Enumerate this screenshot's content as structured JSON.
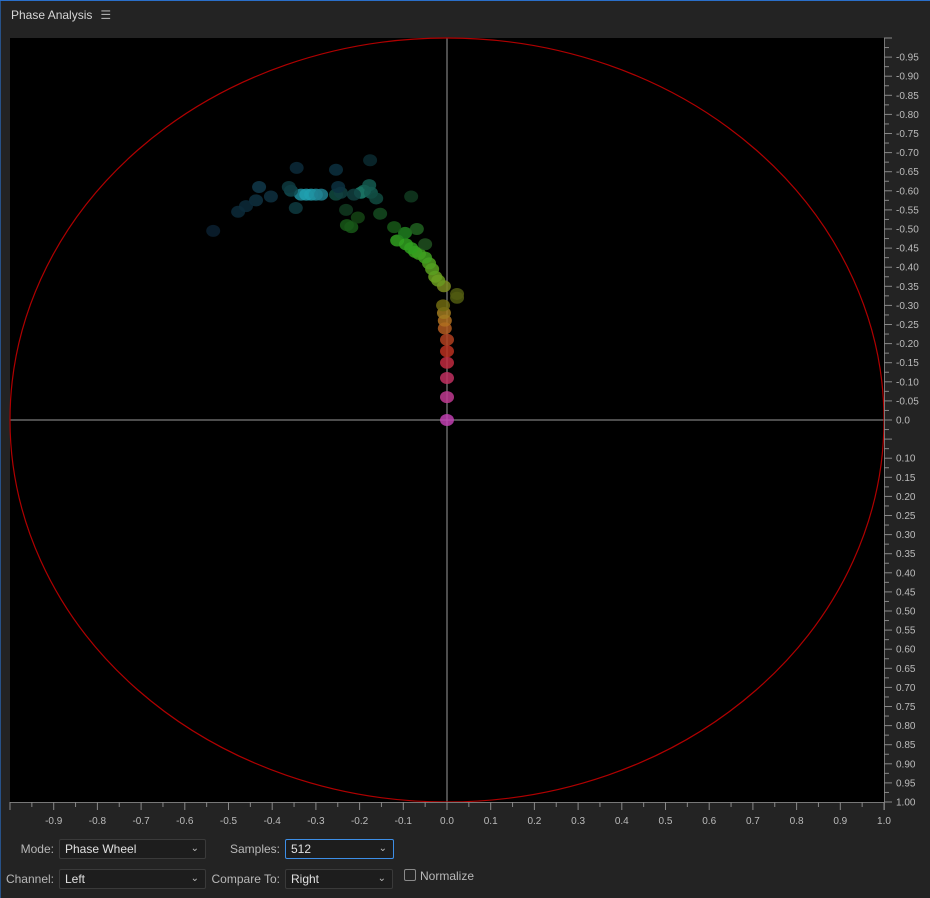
{
  "panel": {
    "title": "Phase Analysis",
    "menu_icon": "hamburger-menu-icon"
  },
  "controls": {
    "mode_label": "Mode:",
    "mode_value": "Phase Wheel",
    "samples_label": "Samples:",
    "samples_value": "512",
    "channel_label": "Channel:",
    "channel_value": "Left",
    "compare_label": "Compare To:",
    "compare_value": "Right",
    "normalize_label": "Normalize",
    "normalize_checked": false
  },
  "chart_data": {
    "type": "scatter",
    "xlim": [
      -1.0,
      1.0
    ],
    "ylim": [
      -1.0,
      1.0
    ],
    "x_ticks": [
      "-0.9",
      "-0.8",
      "-0.7",
      "-0.6",
      "-0.5",
      "-0.4",
      "-0.3",
      "-0.2",
      "-0.1",
      "0.0",
      "0.1",
      "0.2",
      "0.3",
      "0.4",
      "0.5",
      "0.6",
      "0.7",
      "0.8",
      "0.9",
      "1.0"
    ],
    "y_ticks": [
      "-0.95",
      "-0.90",
      "-0.85",
      "-0.80",
      "-0.75",
      "-0.70",
      "-0.65",
      "-0.60",
      "-0.55",
      "-0.50",
      "-0.45",
      "-0.40",
      "-0.35",
      "-0.30",
      "-0.25",
      "-0.20",
      "-0.15",
      "-0.10",
      "-0.05",
      "0.0",
      "0.10",
      "0.15",
      "0.20",
      "0.25",
      "0.30",
      "0.35",
      "0.40",
      "0.45",
      "0.50",
      "0.55",
      "0.60",
      "0.65",
      "0.70",
      "0.75",
      "0.80",
      "0.85",
      "0.90",
      "0.95",
      "1.00"
    ],
    "y_axis_position": "right",
    "crosshair": true,
    "circle_color": "#b00000",
    "crosshair_color": "#9a9a9a",
    "points": [
      {
        "x": 0.0,
        "y": 0.0,
        "color": "#c040b0"
      },
      {
        "x": 0.0,
        "y": -0.06,
        "color": "#c03a90"
      },
      {
        "x": 0.0,
        "y": -0.11,
        "color": "#c03060"
      },
      {
        "x": 0.0,
        "y": -0.15,
        "color": "#c02a40"
      },
      {
        "x": 0.0,
        "y": -0.18,
        "color": "#b83020"
      },
      {
        "x": 0.0,
        "y": -0.21,
        "color": "#b04020"
      },
      {
        "x": -0.005,
        "y": -0.24,
        "color": "#b05a20"
      },
      {
        "x": -0.005,
        "y": -0.26,
        "color": "#b07020"
      },
      {
        "x": -0.007,
        "y": -0.28,
        "color": "#a07a20"
      },
      {
        "x": -0.009,
        "y": -0.3,
        "color": "#706a10"
      },
      {
        "x": -0.007,
        "y": -0.35,
        "color": "#7a8a20"
      },
      {
        "x": 0.023,
        "y": -0.32,
        "color": "#505a10"
      },
      {
        "x": 0.023,
        "y": -0.33,
        "color": "#505a10"
      },
      {
        "x": -0.02,
        "y": -0.365,
        "color": "#6a9a20"
      },
      {
        "x": -0.027,
        "y": -0.375,
        "color": "#6aa020"
      },
      {
        "x": -0.034,
        "y": -0.395,
        "color": "#5aa020"
      },
      {
        "x": -0.041,
        "y": -0.41,
        "color": "#50a020"
      },
      {
        "x": -0.05,
        "y": -0.425,
        "color": "#40a020"
      },
      {
        "x": -0.064,
        "y": -0.435,
        "color": "#40a020"
      },
      {
        "x": -0.073,
        "y": -0.44,
        "color": "#38a020"
      },
      {
        "x": -0.082,
        "y": -0.45,
        "color": "#30a020"
      },
      {
        "x": -0.094,
        "y": -0.46,
        "color": "#30a020"
      },
      {
        "x": -0.114,
        "y": -0.47,
        "color": "#30a020"
      },
      {
        "x": -0.096,
        "y": -0.49,
        "color": "#208020"
      },
      {
        "x": -0.069,
        "y": -0.5,
        "color": "#206020"
      },
      {
        "x": -0.05,
        "y": -0.46,
        "color": "#205020"
      },
      {
        "x": -0.121,
        "y": -0.505,
        "color": "#185818"
      },
      {
        "x": -0.219,
        "y": -0.505,
        "color": "#185818"
      },
      {
        "x": -0.229,
        "y": -0.51,
        "color": "#185818"
      },
      {
        "x": -0.204,
        "y": -0.53,
        "color": "#144414"
      },
      {
        "x": -0.153,
        "y": -0.54,
        "color": "#144a20"
      },
      {
        "x": -0.082,
        "y": -0.585,
        "color": "#103a20"
      },
      {
        "x": -0.231,
        "y": -0.55,
        "color": "#103a20"
      },
      {
        "x": -0.197,
        "y": -0.595,
        "color": "#1a8070"
      },
      {
        "x": -0.19,
        "y": -0.6,
        "color": "#1a7060"
      },
      {
        "x": -0.174,
        "y": -0.595,
        "color": "#145a50"
      },
      {
        "x": -0.178,
        "y": -0.615,
        "color": "#145a50"
      },
      {
        "x": -0.162,
        "y": -0.58,
        "color": "#104a40"
      },
      {
        "x": -0.254,
        "y": -0.59,
        "color": "#104a40"
      },
      {
        "x": -0.243,
        "y": -0.595,
        "color": "#104040"
      },
      {
        "x": -0.213,
        "y": -0.59,
        "color": "#104040"
      },
      {
        "x": -0.334,
        "y": -0.59,
        "color": "#2090a0"
      },
      {
        "x": -0.322,
        "y": -0.59,
        "color": "#20a0b0"
      },
      {
        "x": -0.311,
        "y": -0.59,
        "color": "#20a0b0"
      },
      {
        "x": -0.3,
        "y": -0.59,
        "color": "#2090a0"
      },
      {
        "x": -0.288,
        "y": -0.59,
        "color": "#208090"
      },
      {
        "x": -0.357,
        "y": -0.6,
        "color": "#104a50"
      },
      {
        "x": -0.346,
        "y": -0.555,
        "color": "#0e3a40"
      },
      {
        "x": -0.362,
        "y": -0.61,
        "color": "#0e3a40"
      },
      {
        "x": -0.403,
        "y": -0.585,
        "color": "#0e3040"
      },
      {
        "x": -0.43,
        "y": -0.61,
        "color": "#10384a"
      },
      {
        "x": -0.437,
        "y": -0.575,
        "color": "#0e3040"
      },
      {
        "x": -0.46,
        "y": -0.56,
        "color": "#0c2a3a"
      },
      {
        "x": -0.478,
        "y": -0.545,
        "color": "#0c2a3a"
      },
      {
        "x": -0.535,
        "y": -0.495,
        "color": "#0a2030"
      },
      {
        "x": -0.344,
        "y": -0.66,
        "color": "#0c2a3a"
      },
      {
        "x": -0.254,
        "y": -0.655,
        "color": "#0c3040"
      },
      {
        "x": -0.176,
        "y": -0.68,
        "color": "#0a2a30"
      },
      {
        "x": -0.249,
        "y": -0.61,
        "color": "#0c3040"
      }
    ]
  }
}
